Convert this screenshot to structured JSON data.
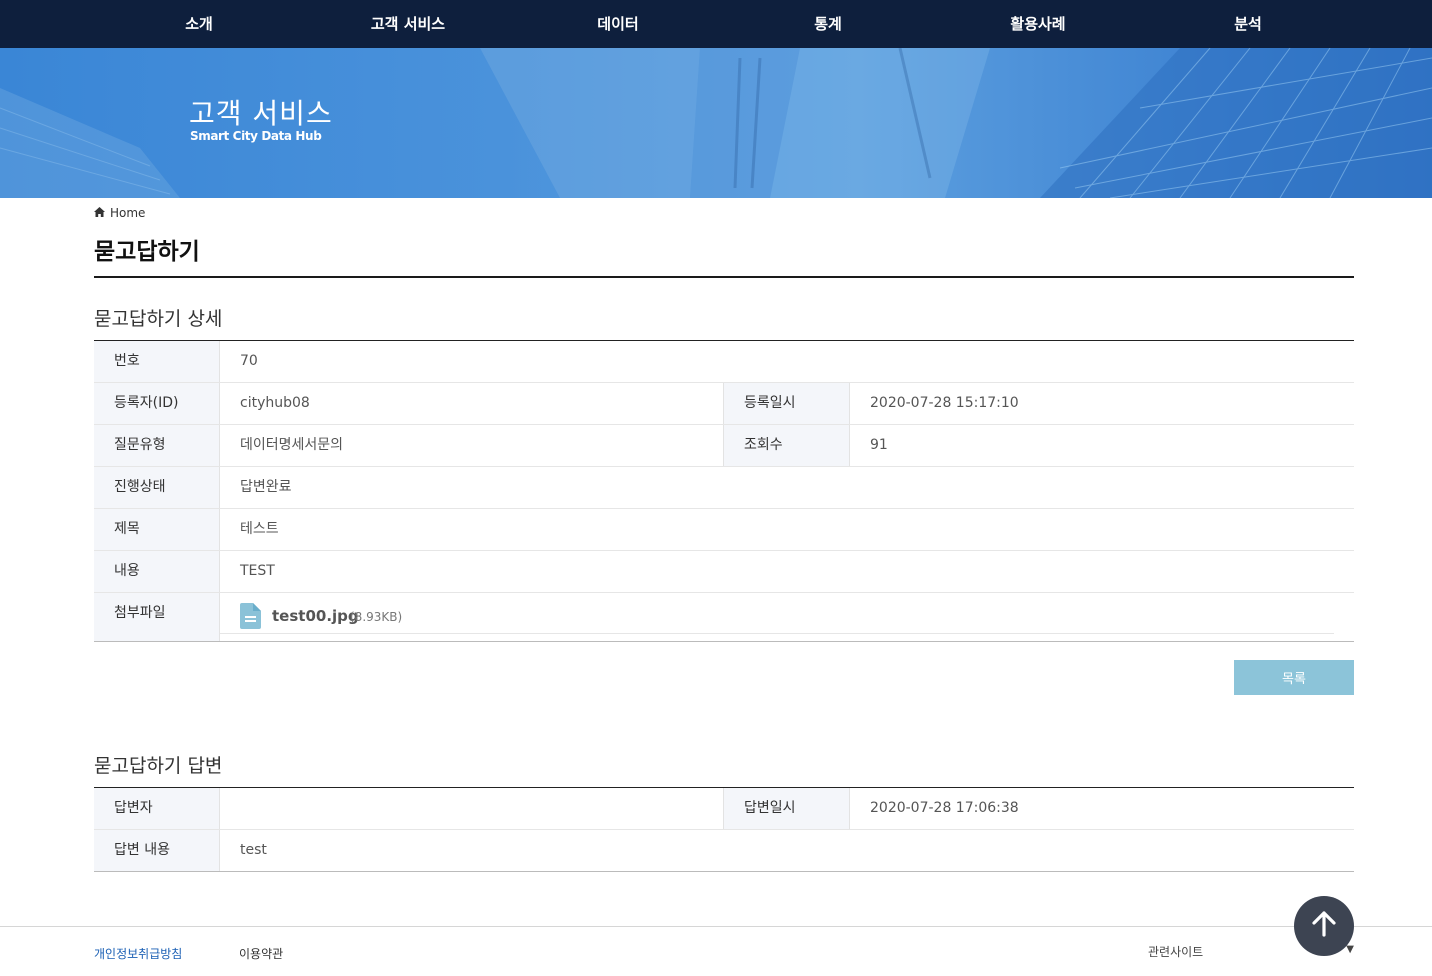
{
  "nav": {
    "items": [
      {
        "label": "소개"
      },
      {
        "label": "고객 서비스"
      },
      {
        "label": "데이터"
      },
      {
        "label": "통계"
      },
      {
        "label": "활용사례"
      },
      {
        "label": "분석"
      }
    ]
  },
  "banner": {
    "title": "고객 서비스",
    "subtitle": "Smart City Data Hub"
  },
  "breadcrumb": {
    "home": "Home",
    "icon": "home-icon"
  },
  "page_title": "묻고답하기",
  "detail": {
    "section_title": "묻고답하기 상세",
    "number_label": "번호",
    "number_value": "70",
    "registrant_label": "등록자(ID)",
    "registrant_value": "cityhub08",
    "reg_date_label": "등록일시",
    "reg_date_value": "2020-07-28 15:17:10",
    "qtype_label": "질문유형",
    "qtype_value": "데이터명세서문의",
    "views_label": "조회수",
    "views_value": "91",
    "status_label": "진행상태",
    "status_value": "답변완료",
    "subject_label": "제목",
    "subject_value": "테스트",
    "content_label": "내용",
    "content_value": "TEST",
    "attach_label": "첨부파일",
    "attach_name": "test00.jpg",
    "attach_size": "(8.93KB)",
    "attach_icon": "file-icon"
  },
  "list_button": "목록",
  "answer": {
    "section_title": "묻고답하기 답변",
    "answerer_label": "답변자",
    "answerer_value": "",
    "date_label": "답변일시",
    "date_value": "2020-07-28 17:06:38",
    "content_label": "답변 내용",
    "content_value": "test"
  },
  "footer": {
    "privacy": "개인정보취급방침",
    "terms": "이용약관",
    "related_sites": "관련사이트",
    "related_arrow": "▼"
  },
  "colors": {
    "nav_bg": "#0e1f3d",
    "banner_blue": "#3a86d6",
    "button": "#8cc4d9",
    "privacy_link": "#1a5fb4",
    "top_button": "#3d4452"
  }
}
